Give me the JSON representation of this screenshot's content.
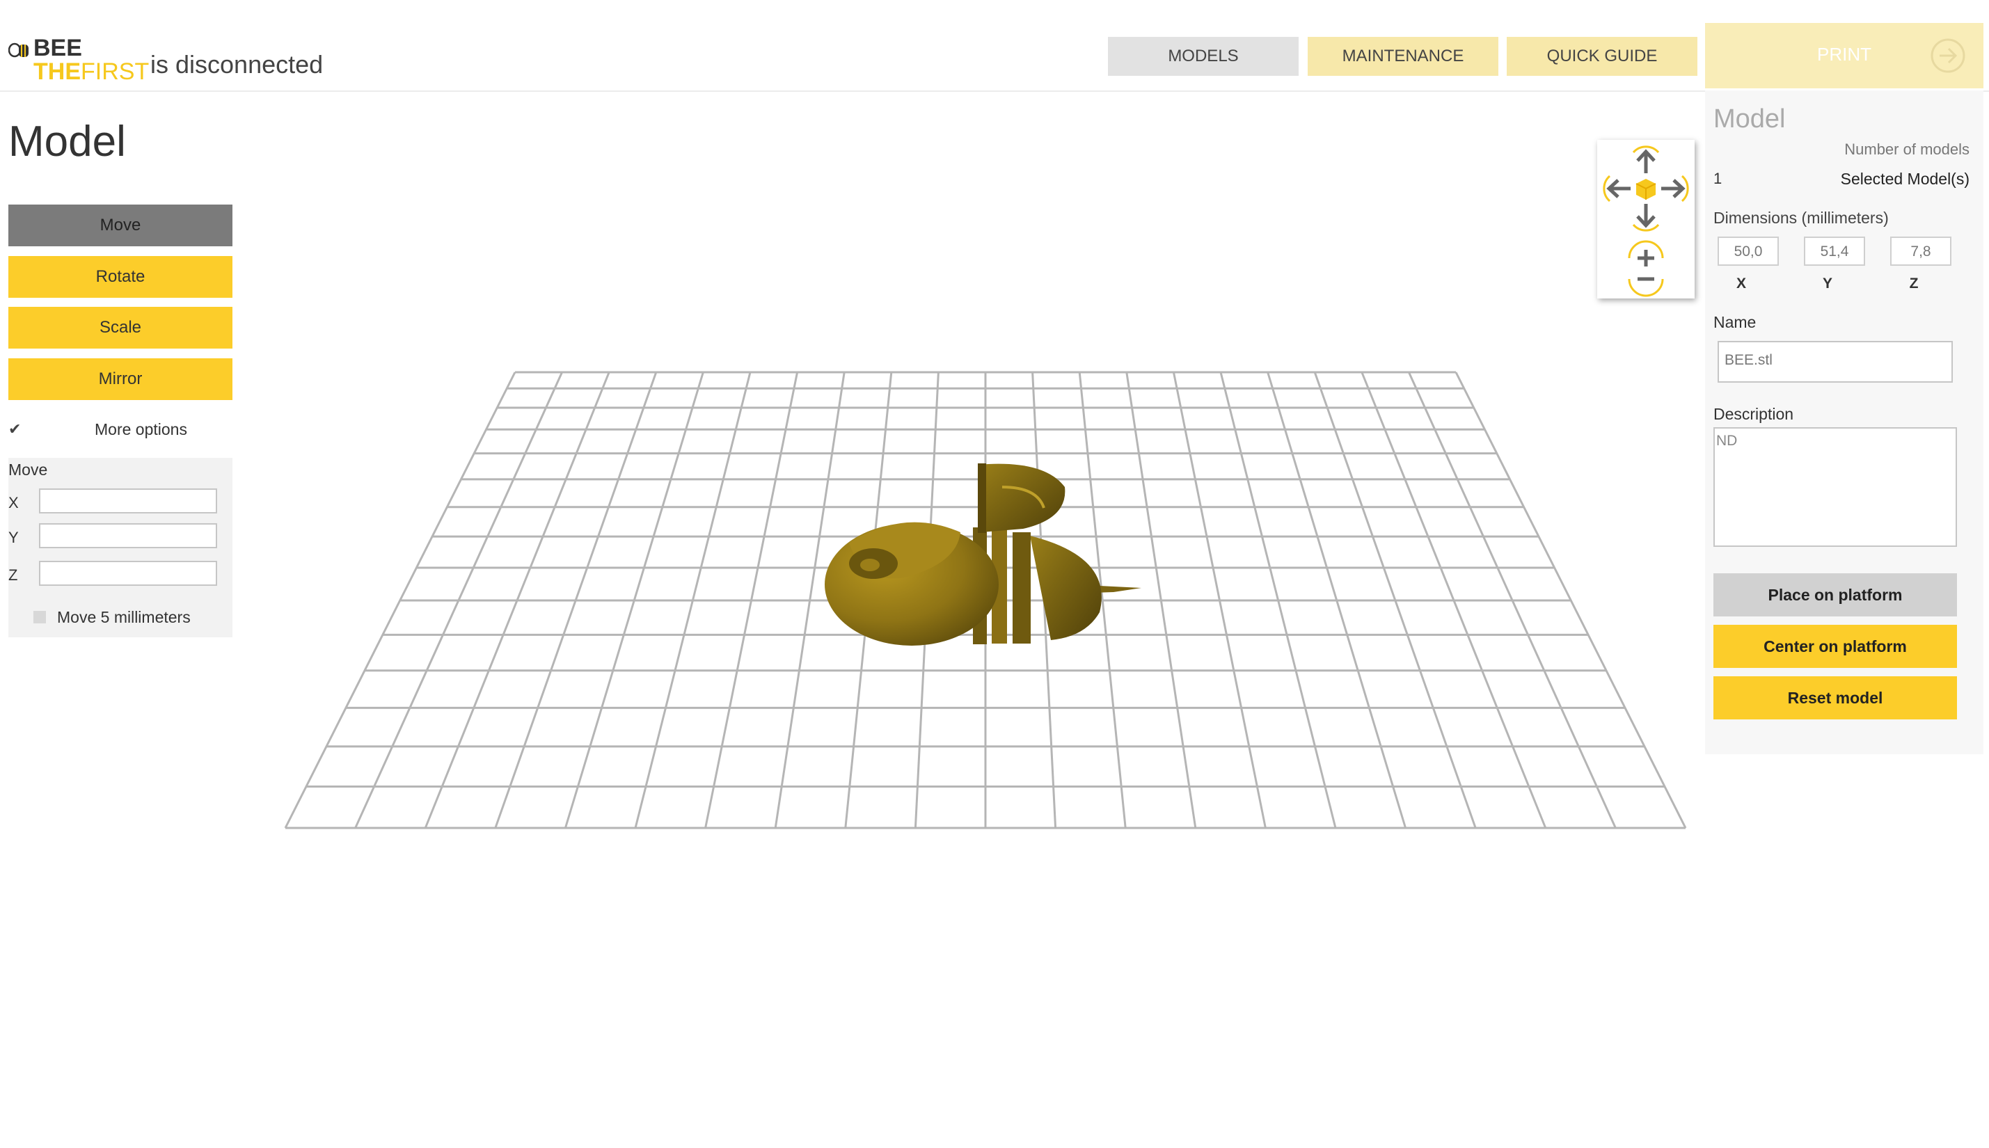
{
  "header": {
    "logo_line1": "BEE",
    "logo_line2_bold": "THE",
    "logo_line2": "FIRST",
    "status": "is disconnected",
    "nav": {
      "models": "MODELS",
      "maintenance": "MAINTENANCE",
      "quick_guide": "QUICK GUIDE"
    },
    "print_label": "PRINT"
  },
  "left": {
    "title": "Model",
    "buttons": {
      "move": "Move",
      "rotate": "Rotate",
      "scale": "Scale",
      "mirror": "Mirror"
    },
    "more_options": "More options",
    "move_panel": {
      "title": "Move",
      "x_label": "X",
      "y_label": "Y",
      "z_label": "Z",
      "x_value": "",
      "y_value": "",
      "z_value": "",
      "move_step_label": "Move 5 millimeters"
    }
  },
  "right": {
    "title": "Model",
    "number_of_models_label": "Number of models",
    "number_of_models": "1",
    "selected_label": "Selected Model(s)",
    "dimensions_label": "Dimensions (millimeters)",
    "dims": {
      "x": "50,0",
      "y": "51,4",
      "z": "7,8"
    },
    "dim_labels": {
      "x": "X",
      "y": "Y",
      "z": "Z"
    },
    "name_label": "Name",
    "name_value": "BEE.stl",
    "description_label": "Description",
    "description_value": "ND",
    "actions": {
      "place": "Place on platform",
      "center": "Center on platform",
      "reset": "Reset model"
    }
  },
  "colors": {
    "accent": "#fccd2a",
    "accent_light": "#f7e8aa",
    "model": "#8f7415",
    "grid": "#b5b5b5"
  }
}
